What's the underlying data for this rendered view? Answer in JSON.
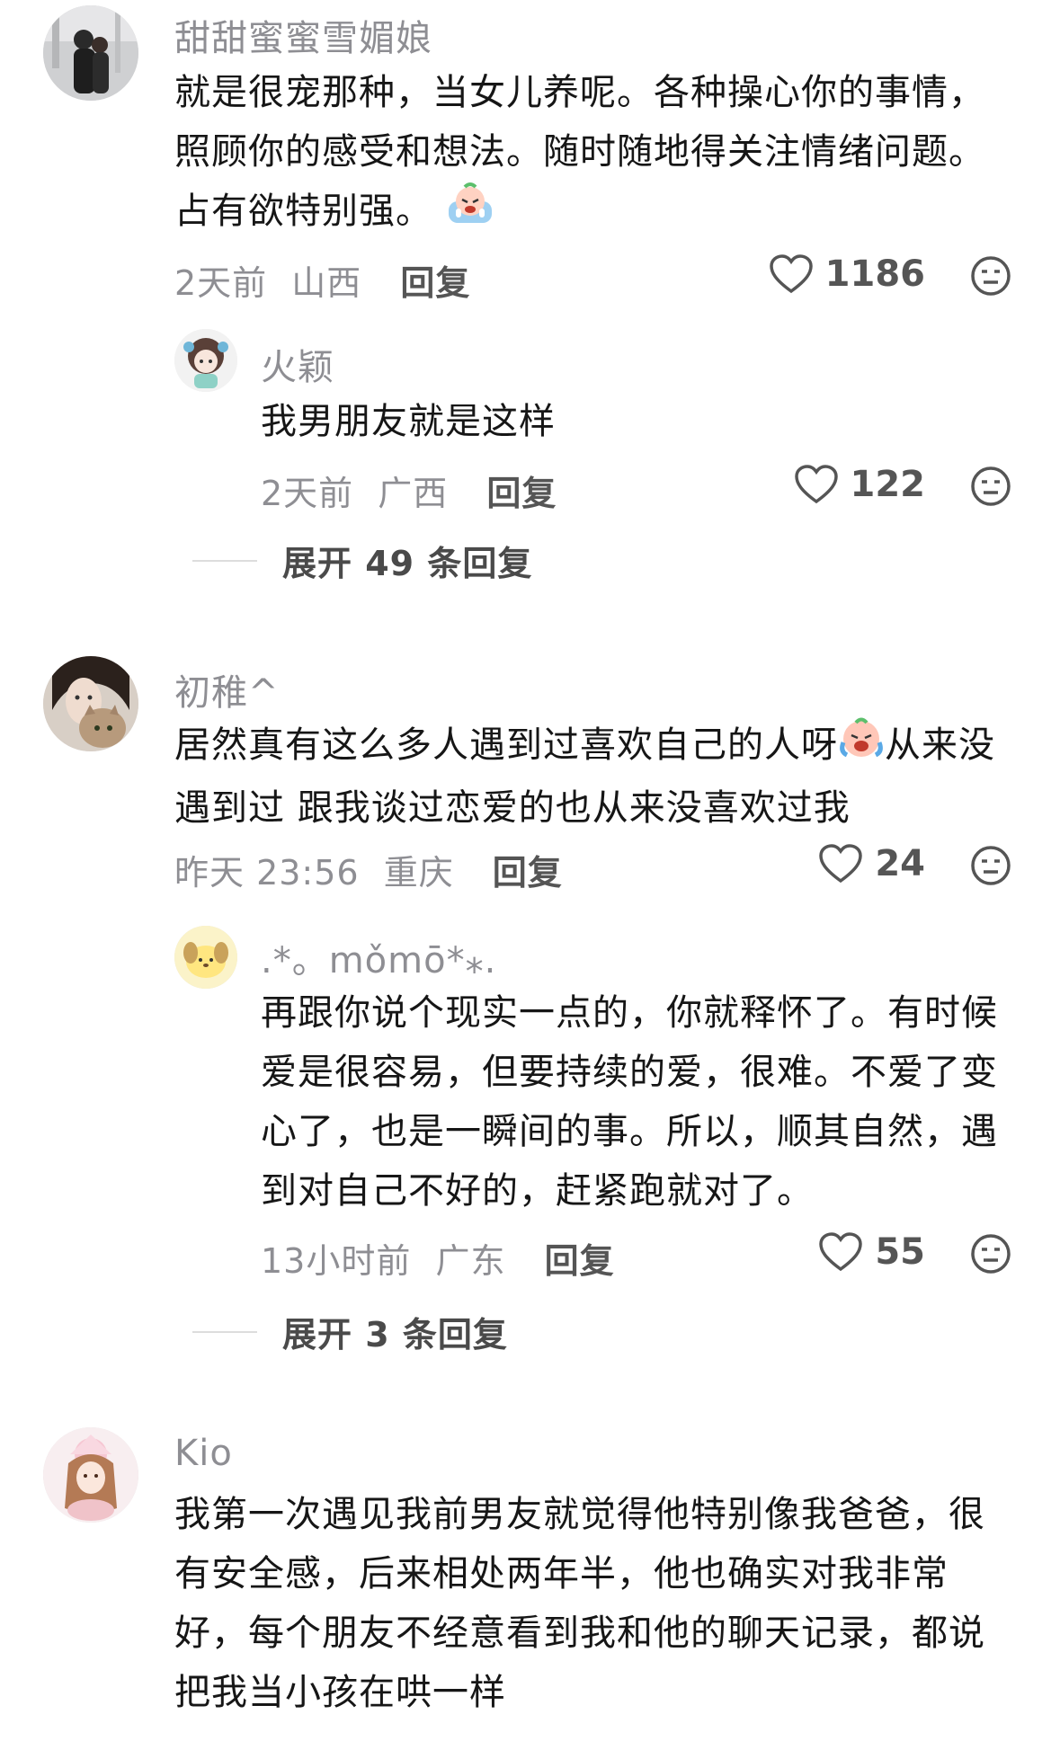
{
  "comments": [
    {
      "username": "甜甜蜜蜜雪媚娘",
      "lines": [
        "就是很宠那种，当女儿养呢。各种操心你的事情，",
        "照顾你的感受和想法。随时随地得关注情绪问题。",
        "占有欲特别强。"
      ],
      "time": "2天前",
      "location": "山西",
      "reply_label": "回复",
      "likes": "1186",
      "replies": [
        {
          "username": "火颖",
          "lines": [
            "我男朋友就是这样"
          ],
          "time": "2天前",
          "location": "广西",
          "reply_label": "回复",
          "likes": "122"
        }
      ],
      "expand_label": "展开 49 条回复"
    },
    {
      "username": "初稚^",
      "line1a": "居然真有这么多人遇到过喜欢自己的人呀",
      "line1b": "从来没",
      "line2": "遇到过 跟我谈过恋爱的也从来没喜欢过我",
      "time": "昨天 23:56",
      "location": "重庆",
      "reply_label": "回复",
      "likes": "24",
      "replies": [
        {
          "username": ".*。mǒmō*⁎.",
          "lines": [
            "再跟你说个现实一点的，你就释怀了。有时候",
            "爱是很容易，但要持续的爱，很难。不爱了变",
            "心了，也是一瞬间的事。所以，顺其自然，遇",
            "到对自己不好的，赶紧跑就对了。"
          ],
          "time": "13小时前",
          "location": "广东",
          "reply_label": "回复",
          "likes": "55"
        }
      ],
      "expand_label": "展开 3 条回复"
    },
    {
      "username": "Kio",
      "lines": [
        "我第一次遇见我前男友就觉得他特别像我爸爸，很",
        "有安全感，后来相处两年半，他也确实对我非常",
        "好，每个朋友不经意看到我和他的聊天记录，都说",
        "把我当小孩在哄一样"
      ]
    }
  ],
  "icons": {
    "like": "heart-outline-icon",
    "dislike": "neutral-face-icon"
  },
  "colors": {
    "meta_gray": "#8e8e93",
    "text": "#161616",
    "reply_link": "#555555"
  }
}
